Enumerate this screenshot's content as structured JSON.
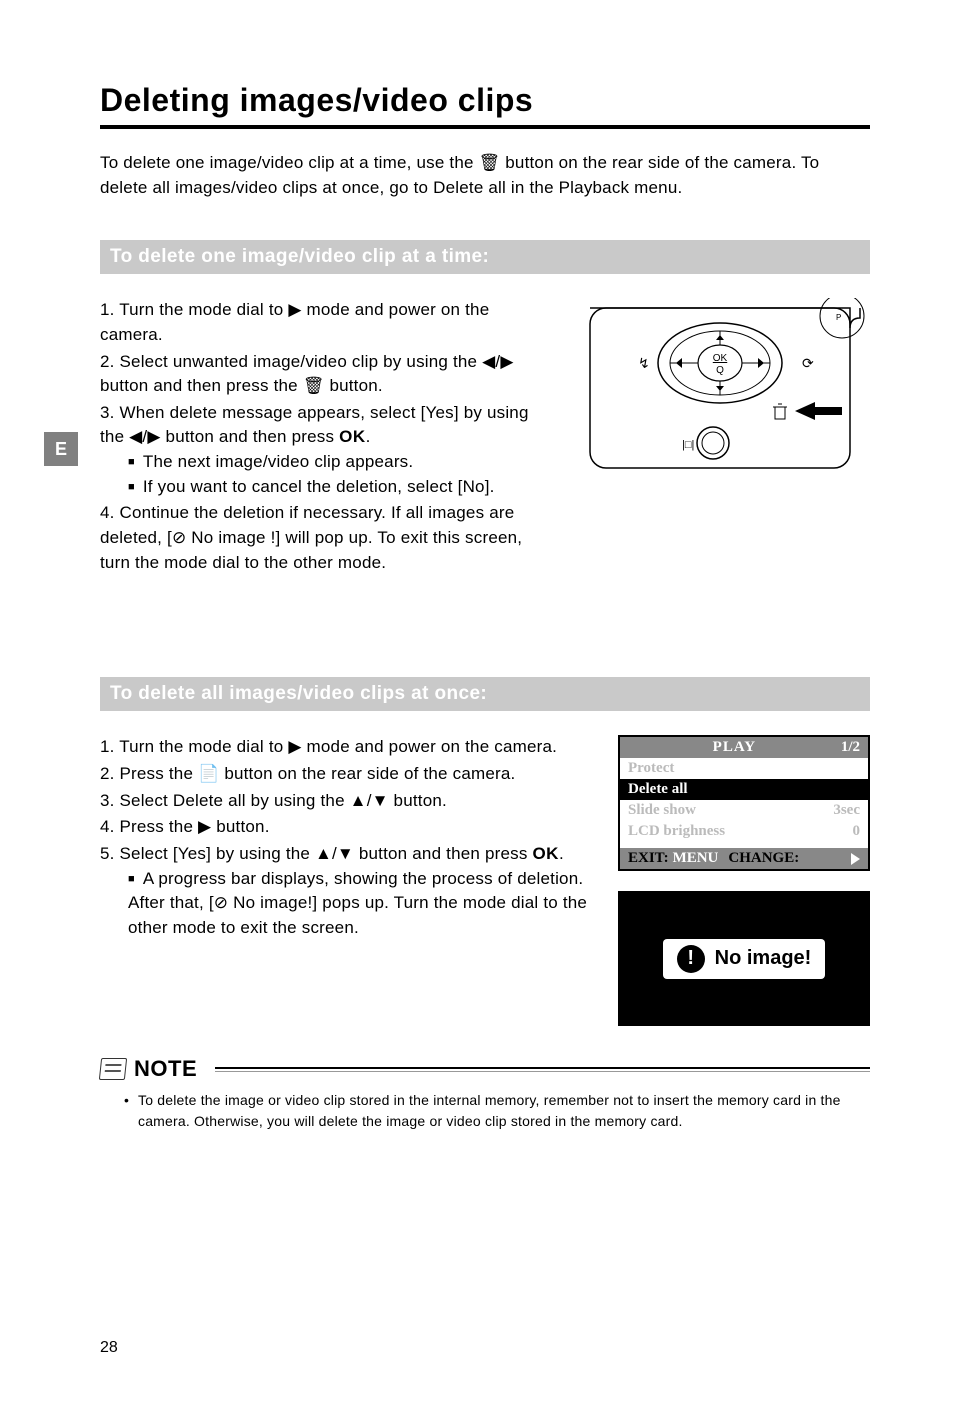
{
  "side_tab": "E",
  "title": "Deleting images/video clips",
  "intro": "To delete one image/video clip at a time, use the 🗑 button on the rear side of the camera. To delete all images/video clips at once, go to Delete all in the Playback menu.",
  "section1": {
    "heading": "To delete one image/video clip at a time:",
    "steps": {
      "s1": "1. Turn the mode dial to ▶ mode and power on the camera.",
      "s2": "2. Select unwanted image/video clip by using the ◀/▶ button and then press the 🗑 button.",
      "s3a": "3. When delete message appears, select [Yes] by using the ◀/▶ button and then press ",
      "s3b": ".",
      "s3_sub1": "The next image/video clip appears.",
      "s3_sub2": "If you want to cancel the deletion, select [No].",
      "s4": "4. Continue the deletion if necessary. If all images are deleted, [⊘ No image !] will pop up. To exit this screen, turn the mode dial to the other mode."
    }
  },
  "section2": {
    "heading": "To delete all images/video clips at once:",
    "steps": {
      "s1": "1. Turn the mode dial to ▶ mode and power on the camera.",
      "s2": "2. Press the 📄 button on the rear side of the camera.",
      "s3": "3. Select Delete all by using the ▲/▼ button.",
      "s4": "4. Press the ▶ button.",
      "s5a": "5. Select [Yes] by using the ▲/▼ button and then press ",
      "s5b": ".",
      "s5_sub1": "A progress bar displays, showing the process of deletion. After that, [⊘ No image!] pops up. Turn the mode dial to the other mode to exit the screen."
    }
  },
  "ok_label": "OK",
  "menu": {
    "title": "PLAY",
    "page": "1/2",
    "rows": [
      {
        "label": "Protect",
        "value": ""
      },
      {
        "label": "Delete all",
        "value": ""
      },
      {
        "label": "Slide show",
        "value": "3sec"
      },
      {
        "label": "LCD brighness",
        "value": "0"
      }
    ],
    "footer_exit": "EXIT:",
    "footer_menu": "MENU",
    "footer_change": "CHANGE:"
  },
  "noimage": {
    "text": "No image!"
  },
  "note": {
    "label": "NOTE",
    "item": "To delete the image or video clip stored in the internal memory, remember not to insert the memory card in the camera. Otherwise, you will delete the image or video clip stored in the memory card."
  },
  "page_number": "28",
  "diagram": {
    "ok": "OK",
    "q": "Q"
  }
}
